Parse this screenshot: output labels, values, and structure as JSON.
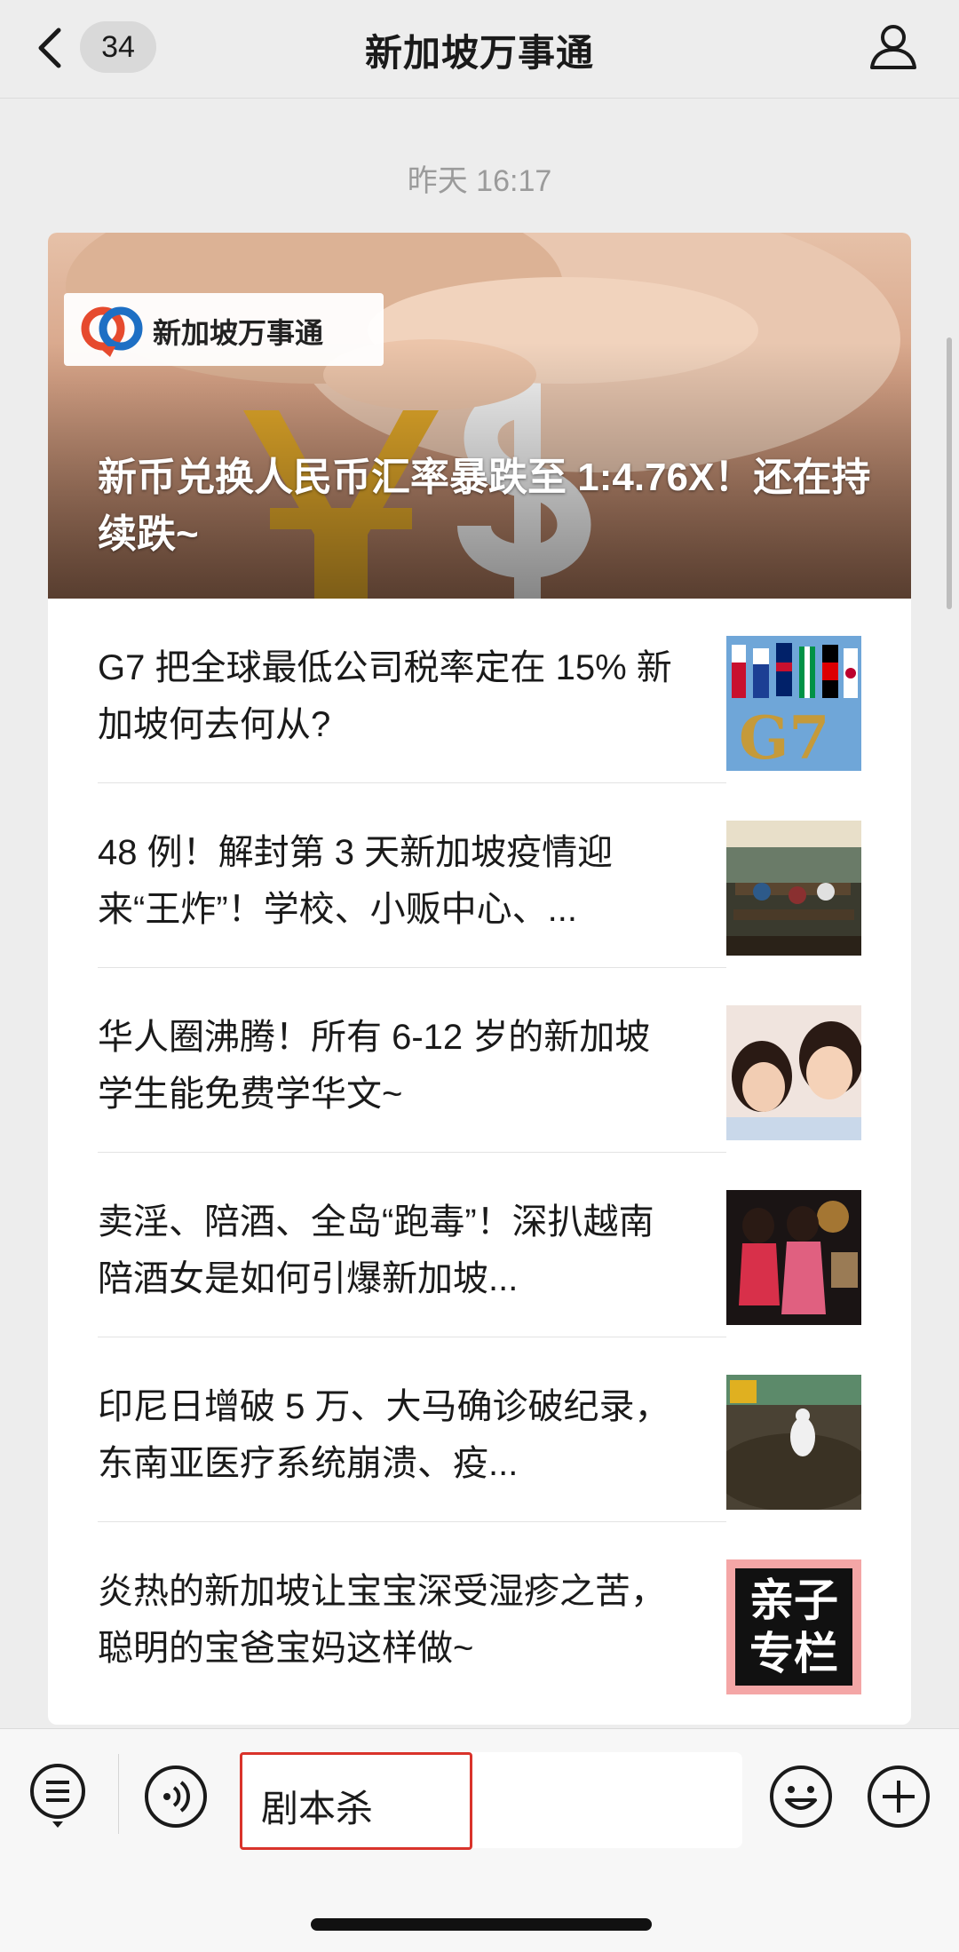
{
  "header": {
    "unread_count": "34",
    "title": "新加坡万事通"
  },
  "timestamp": "昨天 16:17",
  "hero": {
    "logo_text": "新加坡万事通",
    "title": "新币兑换人民币汇率暴跌至 1:4.76X！还在持续跌~"
  },
  "articles": [
    {
      "title": "G7 把全球最低公司税率定在 15% 新加坡何去何从?",
      "thumb": "g7-flags"
    },
    {
      "title": "48 例！解封第 3 天新加坡疫情迎来“王炸”！学校、小贩中心、...",
      "thumb": "hawker-center"
    },
    {
      "title": "华人圈沸腾！所有 6-12 岁的新加坡学生能免费学华文~",
      "thumb": "children"
    },
    {
      "title": "卖淫、陪酒、全岛“跑毒”！深扒越南陪酒女是如何引爆新加坡...",
      "thumb": "bar-women"
    },
    {
      "title": "印尼日增破 5 万、大马确诊破纪录，东南亚医疗系统崩溃、疫...",
      "thumb": "burial-site"
    },
    {
      "title": "炎热的新加坡让宝宝深受湿疹之苦，聪明的宝爸宝妈这样做~",
      "thumb": "parenting-column",
      "thumb_text": "亲子专栏"
    }
  ],
  "input": {
    "value": "剧本杀"
  },
  "colors": {
    "highlight": "#d9332b",
    "background": "#ededed"
  }
}
